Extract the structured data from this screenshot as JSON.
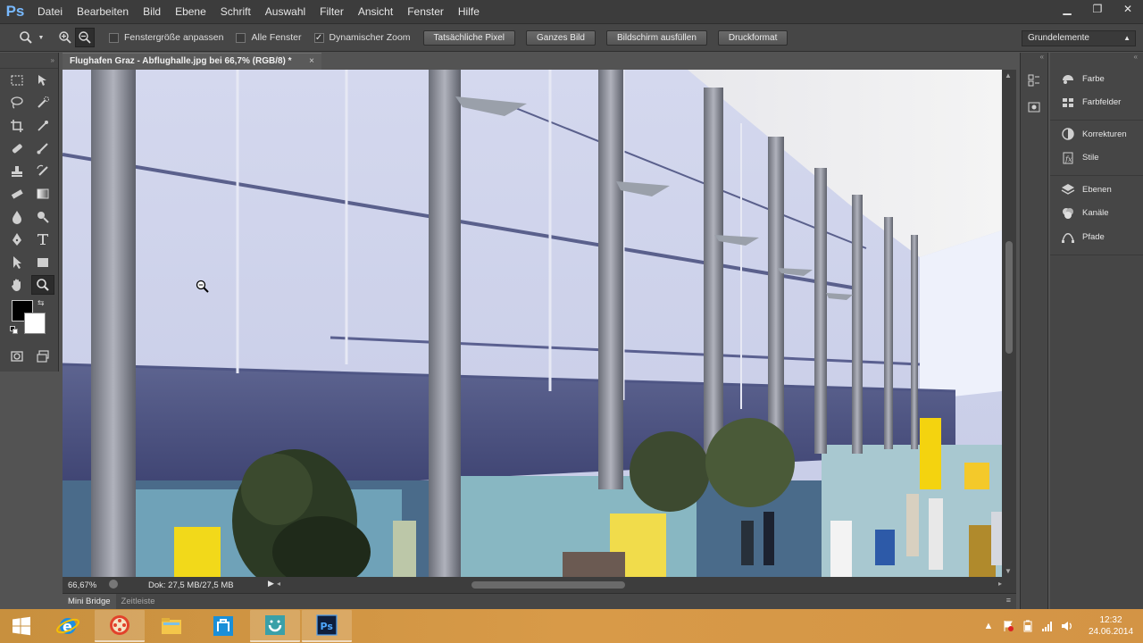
{
  "app": {
    "logo": "Ps"
  },
  "menu": [
    {
      "label": "Datei"
    },
    {
      "label": "Bearbeiten"
    },
    {
      "label": "Bild"
    },
    {
      "label": "Ebene"
    },
    {
      "label": "Schrift"
    },
    {
      "label": "Auswahl"
    },
    {
      "label": "Filter"
    },
    {
      "label": "Ansicht"
    },
    {
      "label": "Fenster"
    },
    {
      "label": "Hilfe"
    }
  ],
  "window_controls": {
    "minimize": "▁",
    "restore": "❐",
    "close": "✕"
  },
  "options": {
    "fit_window": {
      "label": "Fenstergröße anpassen",
      "checked": false
    },
    "all_windows": {
      "label": "Alle Fenster",
      "checked": false
    },
    "scrubby_zoom": {
      "label": "Dynamischer Zoom",
      "checked": true
    },
    "actual_pixels": "Tatsächliche Pixel",
    "fit_screen": "Ganzes Bild",
    "fill_screen": "Bildschirm ausfüllen",
    "print_size": "Druckformat",
    "workspace": "Grundelemente"
  },
  "document": {
    "tab_title": "Flughafen Graz - Abflughalle.jpg bei 66,7% (RGB/8) *",
    "close": "×",
    "zoom": "66,67%",
    "info": "Dok: 27,5 MB/27,5 MB"
  },
  "bottom_tabs": [
    {
      "label": "Mini Bridge"
    },
    {
      "label": "Zeitleiste"
    }
  ],
  "panels": {
    "group1": [
      {
        "label": "Farbe",
        "icon": "color-icon"
      },
      {
        "label": "Farbfelder",
        "icon": "swatches-icon"
      }
    ],
    "group2": [
      {
        "label": "Korrekturen",
        "icon": "adjustments-icon"
      },
      {
        "label": "Stile",
        "icon": "styles-icon"
      }
    ],
    "group3": [
      {
        "label": "Ebenen",
        "icon": "layers-icon"
      },
      {
        "label": "Kanäle",
        "icon": "channels-icon"
      },
      {
        "label": "Pfade",
        "icon": "paths-icon"
      }
    ]
  },
  "taskbar": {
    "time": "12:32",
    "date": "24.06.2014"
  },
  "colors": {
    "foreground": "#000000",
    "background": "#ffffff",
    "accent": "#78b9ff"
  }
}
